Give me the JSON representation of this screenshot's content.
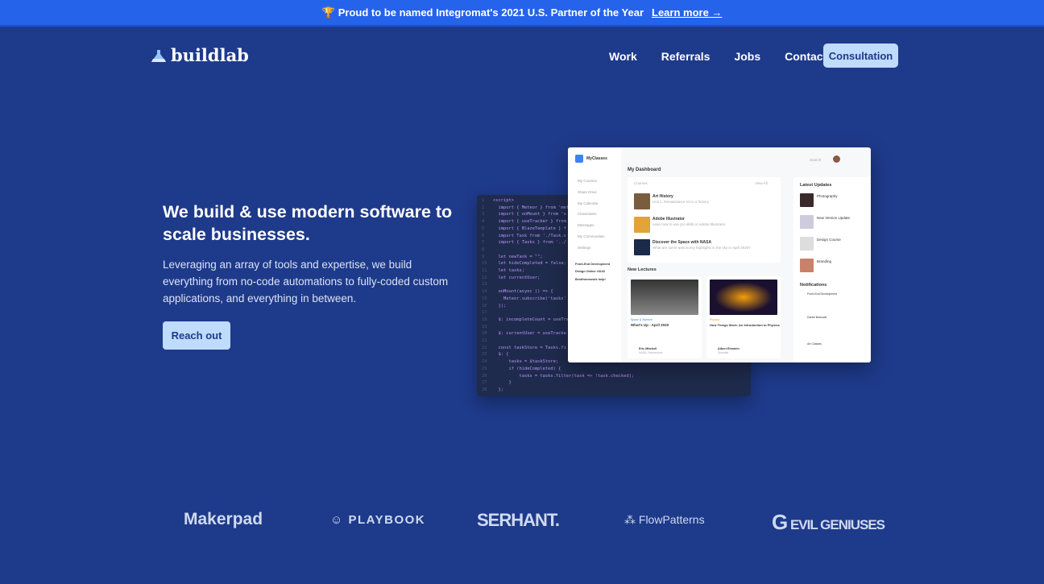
{
  "banner": {
    "icon": "trophy-icon",
    "text": "Proud to be named Integromat's 2021 U.S. Partner of the Year",
    "link": "Learn more →"
  },
  "nav": {
    "logo": "buildlab",
    "links": [
      "Work",
      "Referrals",
      "Jobs",
      "Contact"
    ],
    "cta": "Consultation"
  },
  "hero": {
    "title": "We build & use modern software to scale businesses.",
    "body": "Leveraging an array of tools and expertise, we build everything from no-code automations to fully-coded custom applications, and everything in between.",
    "button": "Reach out"
  },
  "code": [
    "<script>",
    "  import { Meteor } from 'met",
    "  import { onMount } from 's",
    "  import { useTracker } from",
    "  import { BlazeTemplate } f",
    "  import Task from './Task.s",
    "  import { Tasks } from '../",
    "",
    "  let newTask = \"\";",
    "  let hideCompleted = false;",
    "  let tasks;",
    "  let currentUser;",
    "",
    "  onMount(async () => {",
    "    Meteor.subscribe('tasks'",
    "  });",
    "",
    "  $: incompleteCount = useTra",
    "",
    "  $: currentUser = useTracke",
    "",
    "  const taskStore = Tasks.fi",
    "  $: {",
    "      tasks = $taskStore;",
    "      if (hideCompleted) {",
    "          tasks = tasks.filter(task => !task.checked);",
    "      }",
    "  };"
  ],
  "dashboard": {
    "app": "MyClasses",
    "sidebar": [
      "My Courses",
      "Share Drive",
      "My Calendar",
      "Classmates",
      "Messages",
      "My Communities",
      "Settings"
    ],
    "groups": [
      "Front-End Development",
      "Design Online #3142",
      "Bestfromework help!"
    ],
    "search": "Search",
    "title": "My Dashboard",
    "courses_label": "Courses",
    "view_all": "View All",
    "courses": [
      {
        "name": "Art History",
        "desc": "Unit 1: Renaissance Art in a history"
      },
      {
        "name": "Adobe Illustrator",
        "desc": "Lean how to use pro skills in Adobe Illustrator"
      },
      {
        "name": "Discover the Space with NASA",
        "desc": "What are some astronomy highlights in the sky in April 2020?"
      }
    ],
    "new_lectures": "New Lectures",
    "lectures": [
      {
        "tag": "Space & Science",
        "title": "What's Up - April 2020",
        "author": "Eric Mitchell",
        "role": "NASA, Researcher"
      },
      {
        "tag": "Physics",
        "title": "How Things Work: An Introduction to Physics",
        "author": "Albert Einstein",
        "role": "Scientist"
      }
    ],
    "latest_updates": "Latest Updates",
    "updates": [
      "Photography",
      "New Version Update",
      "Design Course",
      "Branding"
    ],
    "notifications": "Notifications",
    "notif": [
      "Front-End Development",
      "Daniel Bobowei",
      "Art Classes"
    ]
  },
  "logos": [
    "Makerpad",
    "PLAYBOOK",
    "SERHANT.",
    "FlowPatterns",
    "EVIL GENIUSES"
  ],
  "colors": {
    "banner": "#2563eb",
    "background": "#1e3a8a",
    "button": "#bfdbfe"
  }
}
